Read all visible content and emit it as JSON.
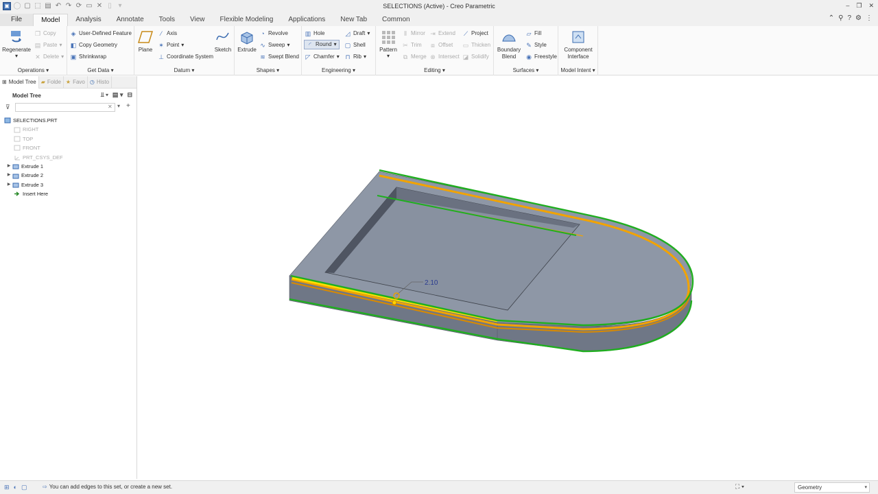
{
  "window": {
    "title": "SELECTIONS (Active) - Creo Parametric",
    "controls": [
      "–",
      "❐",
      "✕"
    ]
  },
  "tabs": [
    {
      "label": "File"
    },
    {
      "label": "Model"
    },
    {
      "label": "Analysis"
    },
    {
      "label": "Annotate"
    },
    {
      "label": "Tools"
    },
    {
      "label": "View"
    },
    {
      "label": "Flexible Modeling"
    },
    {
      "label": "Applications"
    },
    {
      "label": "New Tab"
    },
    {
      "label": "Common"
    }
  ],
  "ribbon": {
    "operations": {
      "label": "Operations",
      "regenerate": "Regenerate",
      "copy": "Copy",
      "paste": "Paste",
      "delete": "Delete"
    },
    "get_data": {
      "label": "Get Data",
      "user_defined_feature": "User-Defined Feature",
      "copy_geometry": "Copy Geometry",
      "shrinkwrap": "Shrinkwrap"
    },
    "datum": {
      "label": "Datum",
      "plane": "Plane",
      "axis": "Axis",
      "point": "Point",
      "coordinate_system": "Coordinate System",
      "sketch": "Sketch"
    },
    "shapes": {
      "label": "Shapes",
      "extrude": "Extrude",
      "revolve": "Revolve",
      "sweep": "Sweep",
      "swept_blend": "Swept Blend"
    },
    "engineering": {
      "label": "Engineering",
      "hole": "Hole",
      "round": "Round",
      "chamfer": "Chamfer",
      "draft": "Draft",
      "shell": "Shell",
      "rib": "Rib"
    },
    "editing": {
      "label": "Editing",
      "pattern": "Pattern",
      "mirror": "Mirror",
      "trim": "Trim",
      "merge": "Merge",
      "extend": "Extend",
      "offset": "Offset",
      "intersect": "Intersect",
      "project": "Project",
      "thicken": "Thicken",
      "solidify": "Solidify"
    },
    "surfaces": {
      "label": "Surfaces",
      "boundary_blend": "Boundary Blend",
      "fill": "Fill",
      "style": "Style",
      "freestyle": "Freestyle"
    },
    "model_intent": {
      "label": "Model Intent",
      "component_interface": "Component Interface"
    }
  },
  "panel": {
    "tabs": [
      "Model Tree",
      "Folde",
      "Favo",
      "Histo"
    ],
    "title": "Model Tree",
    "filter_placeholder": "",
    "items": [
      {
        "label": "SELECTIONS.PRT",
        "icon": "part-icon"
      },
      {
        "label": "RIGHT",
        "icon": "datum-plane-icon"
      },
      {
        "label": "TOP",
        "icon": "datum-plane-icon"
      },
      {
        "label": "FRONT",
        "icon": "datum-plane-icon"
      },
      {
        "label": "PRT_CSYS_DEF",
        "icon": "csys-icon"
      },
      {
        "label": "Extrude 1",
        "icon": "extrude-icon"
      },
      {
        "label": "Extrude 2",
        "icon": "extrude-icon"
      },
      {
        "label": "Extrude 3",
        "icon": "extrude-icon"
      },
      {
        "label": "Insert Here",
        "icon": "insert-arrow-icon"
      }
    ]
  },
  "graphics": {
    "dimension_value": "2.10",
    "colors": {
      "body": "#8e97a6",
      "body_dark": "#6f7786",
      "selected_chain": "#1fae1f",
      "preview": "#f2a300",
      "highlight": "#ffe000"
    }
  },
  "status": {
    "message": "You can add edges to this set, or create a new set.",
    "selection_filter": "Geometry"
  }
}
